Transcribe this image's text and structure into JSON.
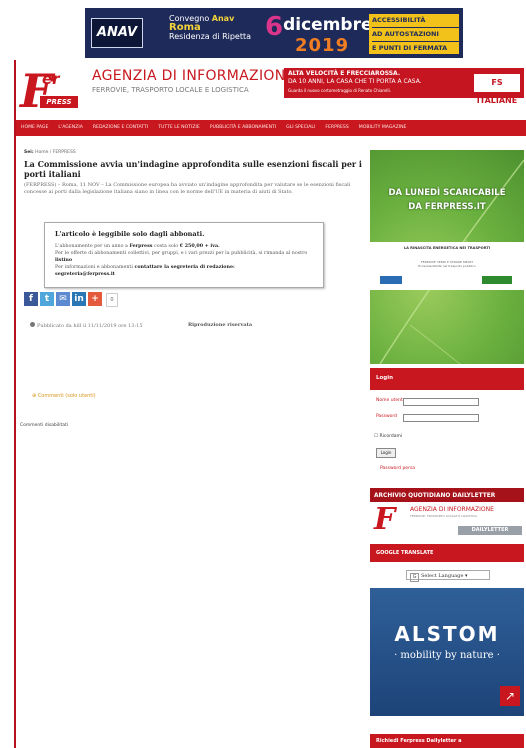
{
  "top_banner": {
    "anav": "ANAV",
    "convegno": "Convegno",
    "convegno_brand": "Anav",
    "roma": "Roma",
    "residenza": "Residenza di Ripetta",
    "day": "6",
    "month": "dicembre",
    "year": "2019",
    "right_lines": [
      "ACCESSIBILITÀ",
      "AD AUTOSTAZIONI",
      "E PUNTI DI FERMATA"
    ]
  },
  "header": {
    "logo_letter": "F",
    "logo_fer": "er",
    "logo_press": "PRESS",
    "title": "AGENZIA DI INFORMAZIONE",
    "subtitle": "FERROVIE, TRASPORTO LOCALE E LOGISTICA",
    "fs_banner_line1": "ALTA VELOCITÀ E FRECCIAROSSA.",
    "fs_banner_line2": "DA 10 ANNI, LA CASA CHE TI PORTA A CASA.",
    "fs_banner_line3": "Guarda il nuovo cortometraggio di Renato Chiarelli.",
    "fs_logo": "FS ITALIANE"
  },
  "nav": {
    "items": [
      "HOME PAGE",
      "L'AGENZIA",
      "REDAZIONE E CONTATTI",
      "TUTTE LE NOTIZIE",
      "PUBBLICITÀ E ABBONAMENTI",
      "GLI SPECIALI",
      "FERPRESS",
      "MOBILITY MAGAZINE"
    ]
  },
  "article": {
    "breadcrumb_you": "Sei:",
    "breadcrumb_path": "Home / FERPRESS",
    "title": "La Commissione avvia un'indagine approfondita sulle esenzioni fiscali per i porti italiani",
    "lead": "(FERPRESS) – Roma, 11 NOV – La Commissione europea ha avviato un'indagine approfondita per valutare se le esenzioni fiscali concesse ai porti dalla legislazione italiana siano in linea con le norme dell'UE in materia di aiuti di Stato.",
    "paywall_heading": "L'articolo è leggibile solo dagli abbonati.",
    "paywall_text_1": "L'abbonamento per un anno a",
    "paywall_brand": "Ferpress",
    "paywall_text_2": "costa solo",
    "paywall_price": "€ 250,00 + iva.",
    "paywall_text_3": "Per le offerte di abbonamenti collettivi, per gruppi, e i vari prezzi per la pubblicità, si rimanda al nostro",
    "paywall_listino": "listino",
    "paywall_text_4": "Per informazioni e abbonamenti",
    "paywall_contact": "contattare la segreteria di redazione:",
    "paywall_email": "segreteria@ferpress.it",
    "social_count": "0",
    "published": "Pubblicato da hill il 11/11/2019 ore 13:15",
    "reproduction": "Riproduzione riservata",
    "comments_toggle": "Commenti (solo utenti)",
    "comments_closed": "Commenti disabilitati"
  },
  "sidebar": {
    "ad1_line1": "DA LUNEDÌ SCARICABILE",
    "ad1_line2": "DA FERPRESS.IT",
    "ad1_strip1": "LA RINASCITA ENERGETICA NEI TRASPORTI",
    "ad1_strip2": "FERROVIE VERDI E STRADE SMART",
    "ad1_strip3": "Ecosostenibilità nel trasporto pubblico",
    "login_title": "Login",
    "username_label": "Nome utente",
    "password_label": "Password",
    "remember": "Ricordami",
    "login_button": "Login",
    "forgot": "Password persa",
    "archive_title": "ARCHIVIO QUOTIDIANO DAILYLETTER",
    "archive_t1": "AGENZIA DI INFORMAZIONE",
    "archive_t2": "FERROVIE, TRASPORTO LOCALE E LOGISTICA",
    "archive_button": "DAILYLETTER",
    "translate_title": "GOOGLE TRANSLATE",
    "translate_select": "Select Language",
    "alstom_name": "ALSTOM",
    "alstom_tag": "· mobility by nature ·",
    "bottom_title": "Richiedi Ferpress Dailyletter a"
  },
  "colors": {
    "brand_red": "#c8171e",
    "ad_green": "#5fa33a",
    "alstom_blue": "#2f5f98",
    "banner_navy": "#1e2a5a"
  }
}
